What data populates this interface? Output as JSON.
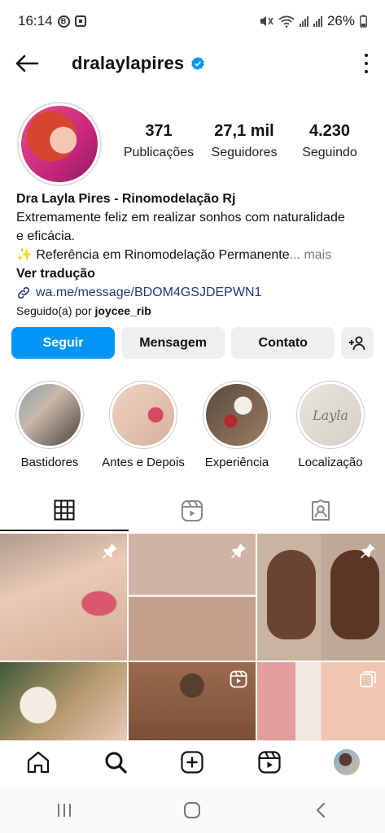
{
  "status_bar": {
    "time": "16:14",
    "battery": "26%"
  },
  "header": {
    "username": "dralaylapires"
  },
  "stats": [
    {
      "value": "371",
      "label": "Publicações"
    },
    {
      "value": "27,1 mil",
      "label": "Seguidores"
    },
    {
      "value": "4.230",
      "label": "Seguindo"
    }
  ],
  "bio": {
    "name": "Dra Layla Pires - Rinomodelação Rj",
    "line1": "Extremamente feliz em realizar sonhos com naturalidade",
    "line2": "e eficácia.",
    "line3": "✨ Referência em Rinomodelação Permanente",
    "more": "... mais",
    "translate": "Ver tradução",
    "link": "wa.me/message/BDOM4GSJDEPWN1",
    "followed_by_prefix": "Seguido(a) por ",
    "followed_by_user": "joycee_rib"
  },
  "actions": {
    "follow": "Seguir",
    "message": "Mensagem",
    "contact": "Contato"
  },
  "highlights": [
    {
      "label": "Bastidores"
    },
    {
      "label": "Antes e Depois"
    },
    {
      "label": "Experiência"
    },
    {
      "label": "Localização",
      "thumb_text": "Layla"
    }
  ],
  "colors": {
    "follow_button": "#0095f6",
    "verified": "#0095f6",
    "link": "#1e3a78"
  }
}
